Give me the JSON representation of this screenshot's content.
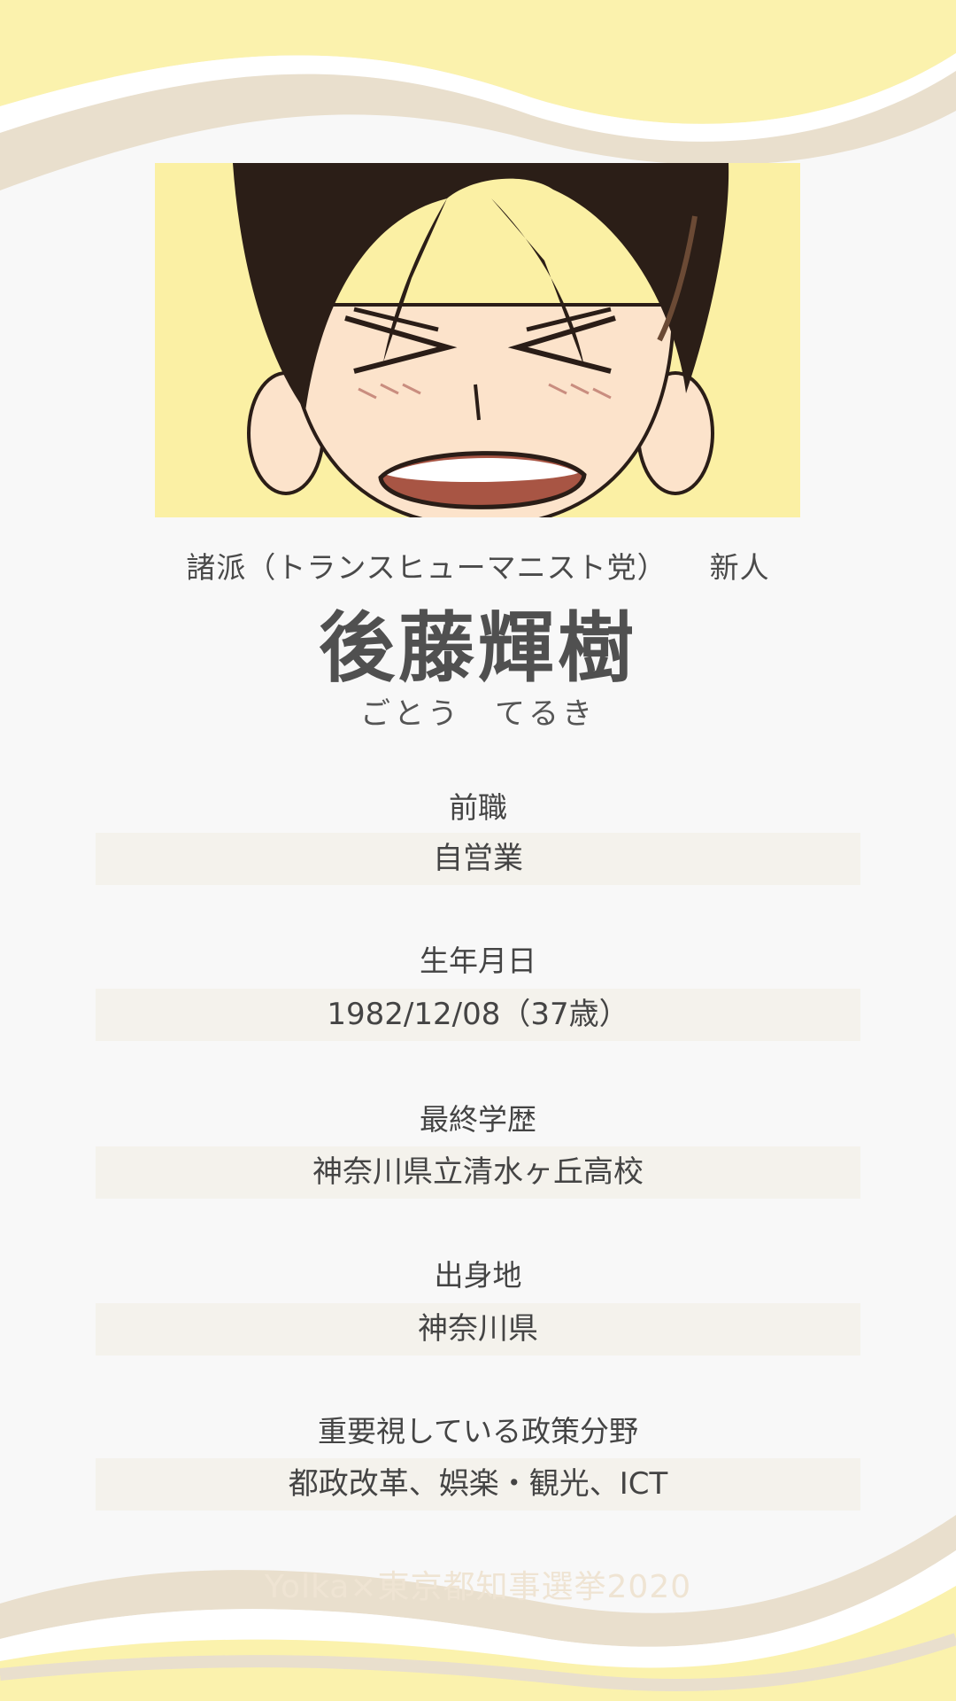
{
  "profile": {
    "affiliation": "諸派（トランスヒューマニスト党）",
    "status": "新人",
    "name": "後藤輝樹",
    "reading": "ごとう　てるき"
  },
  "fields": [
    {
      "label": "前職",
      "value": "自営業"
    },
    {
      "label": "生年月日",
      "value": "1982/12/08（37歳）"
    },
    {
      "label": "最終学歴",
      "value": "神奈川県立清水ヶ丘高校"
    },
    {
      "label": "出身地",
      "value": "神奈川県"
    },
    {
      "label": "重要視している政策分野",
      "value": "都政改革、娯楽・観光、ICT"
    }
  ],
  "footer": "Yolka×東京都知事選挙2020",
  "colors": {
    "background": "#f8f8f8",
    "wave_yellow": "#fbf2ad",
    "wave_beige": "#e9dfcd",
    "value_band": "#f4f2ec",
    "text": "#4a4a4a"
  },
  "icons": [
    "candidate-portrait-illustration"
  ]
}
